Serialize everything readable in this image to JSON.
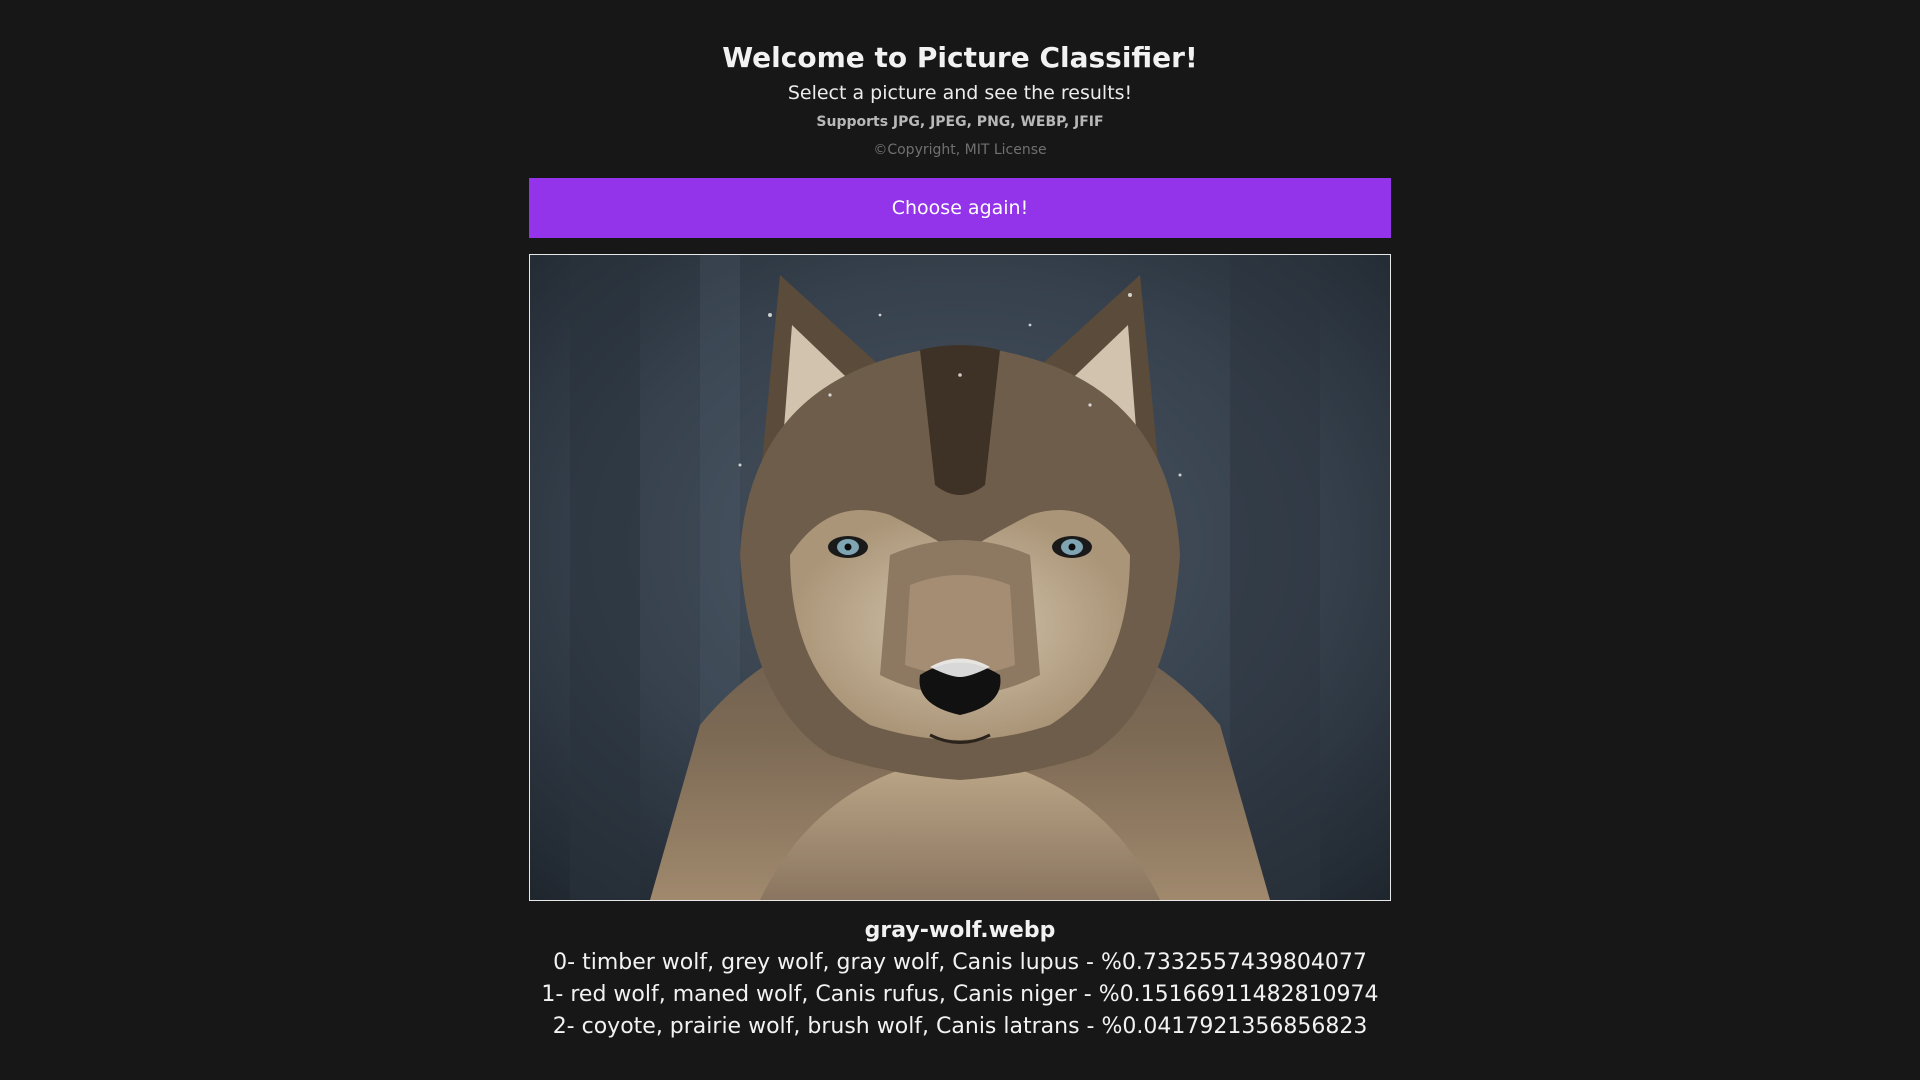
{
  "header": {
    "title": "Welcome to Picture Classifier!",
    "subtitle": "Select a picture and see the results!",
    "formats": "Supports JPG, JPEG, PNG, WEBP, JFIF",
    "copyright": "©Copyright, MIT License"
  },
  "actions": {
    "choose_label": "Choose again!"
  },
  "colors": {
    "background": "#171717",
    "accent": "#9333ea"
  },
  "preview": {
    "subject": "gray wolf photo"
  },
  "results": {
    "filename": "gray-wolf.webp",
    "predictions": [
      "0- timber wolf, grey wolf, gray wolf, Canis lupus - %0.7332557439804077",
      "1- red wolf, maned wolf, Canis rufus, Canis niger - %0.15166911482810974",
      "2- coyote, prairie wolf, brush wolf, Canis latrans - %0.0417921356856823"
    ]
  }
}
